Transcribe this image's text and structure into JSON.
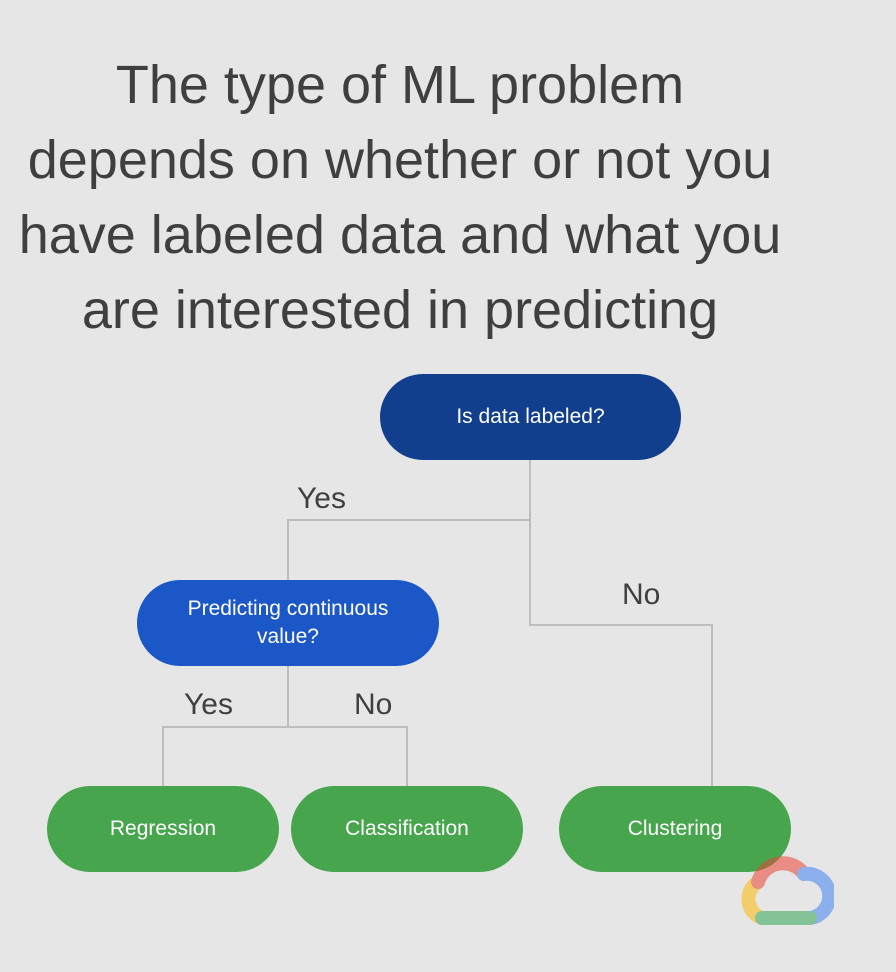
{
  "title": {
    "lines": [
      "The type of ML problem",
      "depends on whether or not you",
      "have labeled data and what you",
      "are interested in predicting"
    ]
  },
  "diagram": {
    "root": {
      "label": "Is data labeled?",
      "color": "#123f8d"
    },
    "branch_root_yes": "Yes",
    "branch_root_no": "No",
    "sub": {
      "label": "Predicting continuous value?",
      "color": "#1b57c6"
    },
    "branch_sub_yes": "Yes",
    "branch_sub_no": "No",
    "leaves": [
      {
        "label": "Regression"
      },
      {
        "label": "Classification"
      },
      {
        "label": "Clustering"
      }
    ],
    "leaf_color": "#47a64d",
    "line_color": "#bdbdbd"
  },
  "logo": {
    "icon": "cloud-logo-icon",
    "colors": [
      "#ea4335",
      "#fbbc04",
      "#34a853",
      "#4285f4"
    ]
  }
}
